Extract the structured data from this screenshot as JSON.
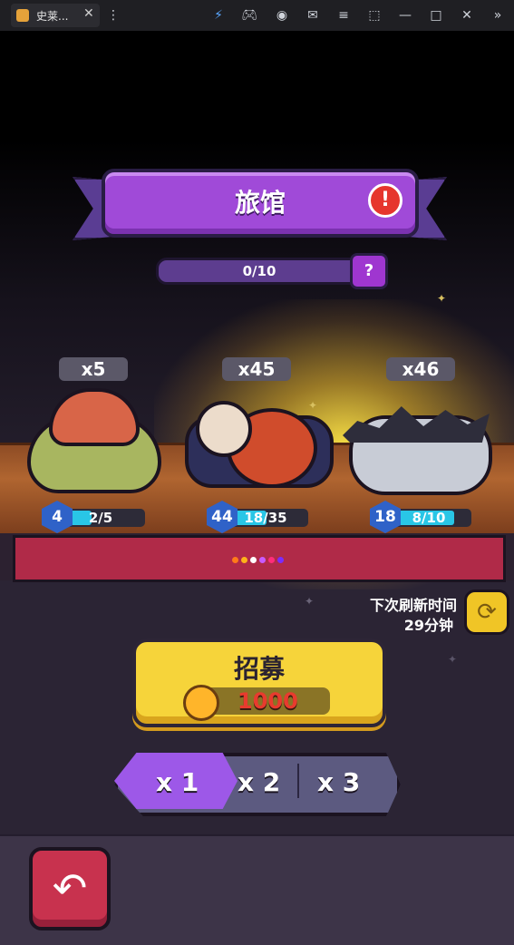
{
  "browser": {
    "tab_title": "史莱...",
    "tab_close": "✕",
    "toolbar_icons": [
      "lightning-icon",
      "gamepad-icon",
      "user-icon",
      "mail-icon",
      "menu-icon",
      "screenshot-icon",
      "minimize-icon",
      "maximize-icon",
      "close-window-icon",
      "expand-icon"
    ]
  },
  "header": {
    "title": "旅馆",
    "alert": "!"
  },
  "progress": {
    "text": "0/10",
    "help": "?"
  },
  "monsters": [
    {
      "count": "x5",
      "level": "4",
      "progress_text": "2/5",
      "fill": 0.4
    },
    {
      "count": "x45",
      "level": "44",
      "progress_text": "18/35",
      "fill": 0.51
    },
    {
      "count": "x46",
      "level": "18",
      "progress_text": "8/10",
      "fill": 0.8
    }
  ],
  "page_dots": {
    "colors": [
      "#ff7a1a",
      "#ffb21a",
      "#ffffff",
      "#c85bff",
      "#ff2c7a",
      "#7a2cff"
    ]
  },
  "refresh": {
    "label": "下次刷新时间",
    "time": "29分钟"
  },
  "recruit": {
    "label": "招募",
    "cost": "1000"
  },
  "multipliers": {
    "options": [
      "x 1",
      "x 2",
      "x 3"
    ],
    "selected": "x 1"
  },
  "colors": {
    "purple_accent": "#a04ad8",
    "recruit_yellow": "#f6d43a",
    "back_red": "#c8324e",
    "cost_red": "#e83b2e"
  }
}
